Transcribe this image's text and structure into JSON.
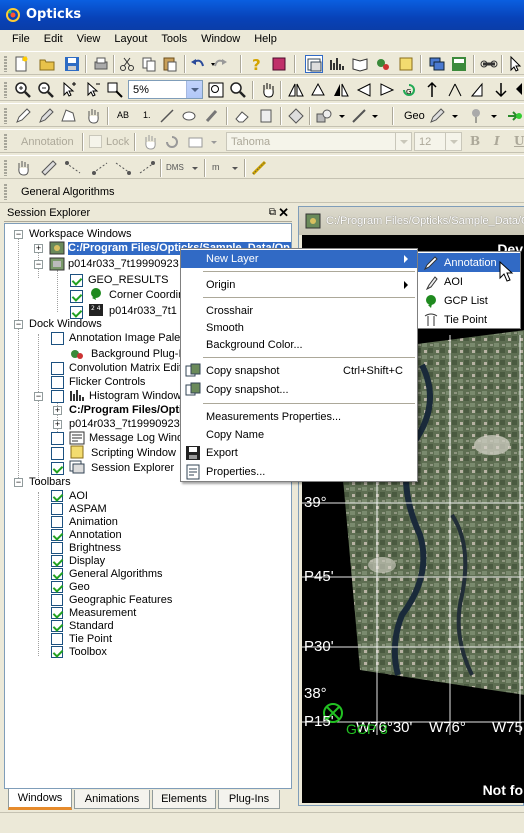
{
  "window": {
    "title": "Opticks"
  },
  "menubar": [
    "File",
    "Edit",
    "View",
    "Layout",
    "Tools",
    "Window",
    "Help"
  ],
  "toolbar": {
    "zoom_value": "5%",
    "annotation_label": "Annotation",
    "lock_label": "Lock",
    "font_name": "Tahoma",
    "font_size": "12",
    "geo_label": "Geo",
    "dms_label": "DMS",
    "m_label": "m",
    "ab_label": "AB",
    "one_label": "1."
  },
  "general_algorithms": "General Algorithms",
  "session_explorer": {
    "title": "Session Explorer",
    "pin": "&#x29C9;",
    "workspace_windows": "Workspace Windows",
    "ws_item1": "C:/Program Files/Opticks/Sample_Data/Op",
    "ws_item2": "p014r033_7t19990923",
    "geo_results": "GEO_RESULTS",
    "corner_coords": "Corner Coordinates",
    "p014_7t1": "p014r033_7t1",
    "dock_windows": "Dock Windows",
    "dock_items": [
      "Annotation Image Palette",
      "Background Plug-Ins",
      "Convolution Matrix Editor",
      "Flicker Controls",
      "Histogram Window"
    ],
    "hist_c": "C:/Program Files/Opticks",
    "hist_p": "p014r033_7t19990923",
    "dock_items2": [
      "Message Log Window",
      "Scripting Window",
      "Session Explorer"
    ],
    "toolbars": "Toolbars",
    "toolbar_items": [
      "AOI",
      "ASPAM",
      "Animation",
      "Annotation",
      "Brightness",
      "Display",
      "General Algorithms",
      "Geo",
      "Geographic Features",
      "Measurement",
      "Standard",
      "Tie Point",
      "Toolbox"
    ],
    "toolbar_checked": [
      true,
      false,
      false,
      true,
      false,
      true,
      true,
      true,
      false,
      true,
      true,
      false,
      true
    ]
  },
  "tabs": [
    "Windows",
    "Animations",
    "Elements",
    "Plug-Ins"
  ],
  "image_window": {
    "title": "C:/Program Files/Opticks/Sample_Data/Op",
    "overlay_top": "Dev",
    "lat_labels": [
      "39°",
      "P45'",
      "P30'",
      "P15'",
      "38°"
    ],
    "lon_labels": [
      "W76°30'",
      "W76°",
      "W75"
    ],
    "gcp_label": "GCP 3",
    "overlay_bottom": "Not fo"
  },
  "context_menu": {
    "items": [
      {
        "label": "New Layer",
        "submenu": true
      },
      {
        "label": "Origin",
        "submenu": true
      },
      {
        "label": "Crosshair"
      },
      {
        "label": "Smooth"
      },
      {
        "label": "Background Color..."
      },
      {
        "label": "Copy snapshot",
        "shortcut": "Ctrl+Shift+C"
      },
      {
        "label": "Copy snapshot..."
      },
      {
        "label": "Measurements Properties..."
      },
      {
        "label": "Copy Name"
      },
      {
        "label": "Export"
      },
      {
        "label": "Properties..."
      }
    ]
  },
  "submenu": {
    "items": [
      "Annotation",
      "AOI",
      "GCP List",
      "Tie Point"
    ]
  },
  "colors": {
    "selection": "#316ac5",
    "gcp_green": "#22c122",
    "titlebar": "#0a5fe0"
  }
}
